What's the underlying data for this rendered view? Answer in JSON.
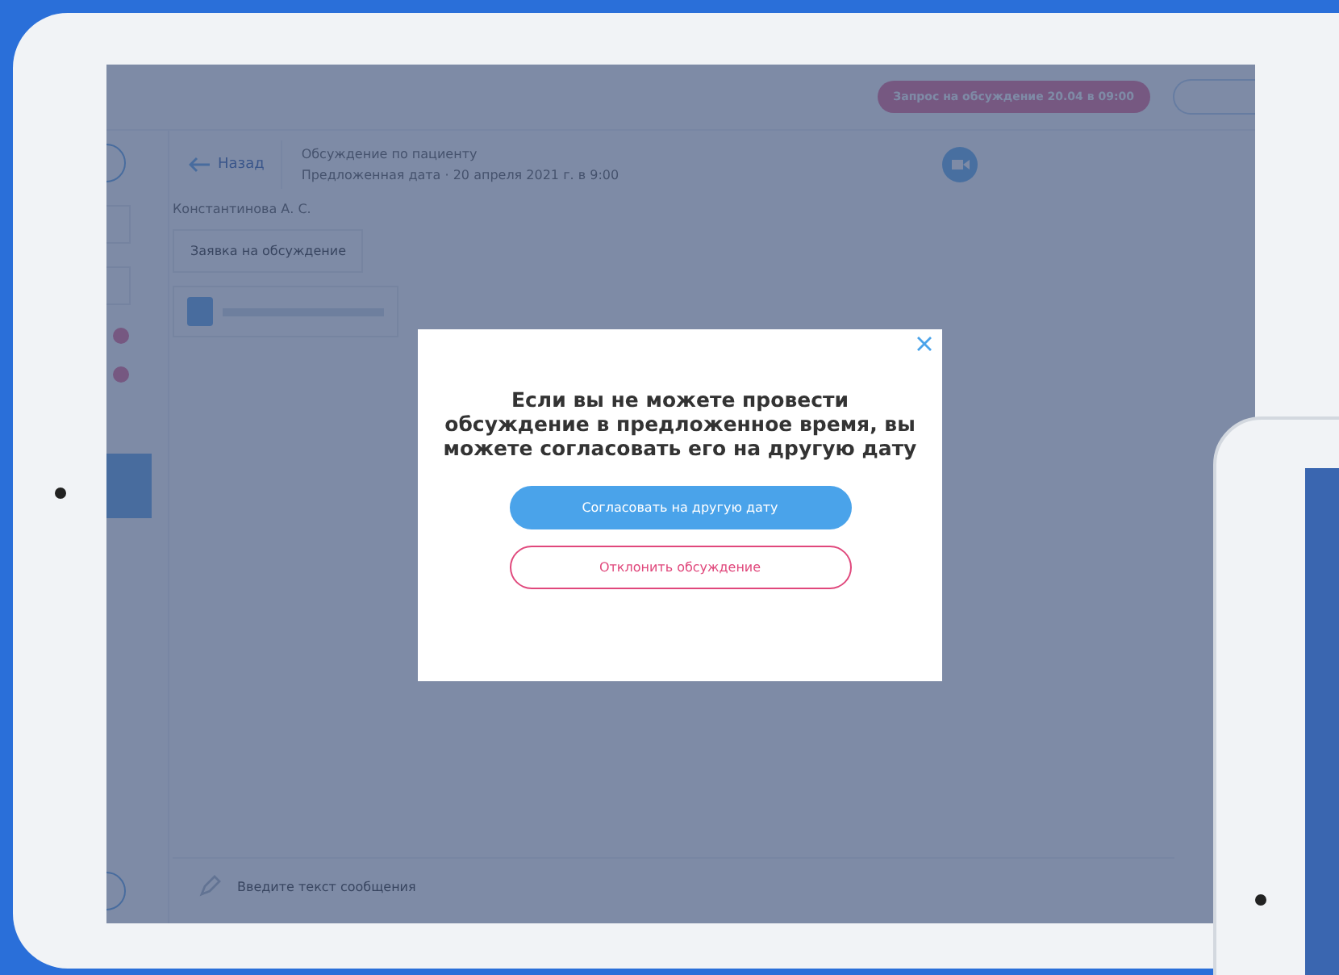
{
  "screen": {
    "request_badge": "Запрос на обсуждение 20.04 в 09:00",
    "header": {
      "back": "Назад",
      "title": "Обсуждение по пациенту",
      "subtitle": "Предложенная дата · 20 апреля 2021 г. в 9:00"
    },
    "author": "Константинова А. С.",
    "tag": "Заявка на обсуждение",
    "message_placeholder": "Введите текст сообщения"
  },
  "dialog": {
    "message": "Если вы не можете провести обсуждение в предложенное время, вы можете согласовать его на другую дату",
    "buttons": [
      {
        "label": "Согласовать на другую дату",
        "kind": "primary"
      },
      {
        "label": "Отклонить обсуждение",
        "kind": "outline"
      }
    ]
  }
}
